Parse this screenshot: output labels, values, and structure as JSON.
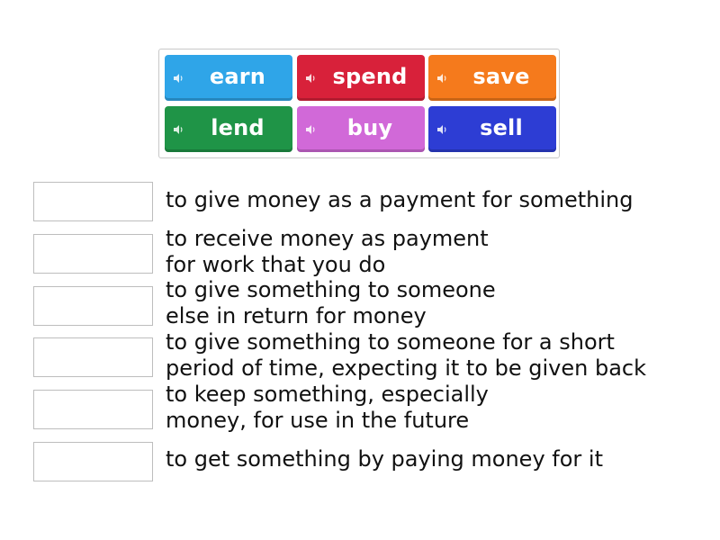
{
  "tiles": [
    {
      "label": "earn",
      "color": "#2fa5e8"
    },
    {
      "label": "spend",
      "color": "#d8213a"
    },
    {
      "label": "save",
      "color": "#f57a1c"
    },
    {
      "label": "lend",
      "color": "#1f9447"
    },
    {
      "label": "buy",
      "color": "#d169d8"
    },
    {
      "label": "sell",
      "color": "#2d3dd4"
    }
  ],
  "tile_icon": "speaker-icon",
  "definitions": [
    {
      "lines": [
        "to give money as a payment for something"
      ]
    },
    {
      "lines": [
        "to receive money as payment",
        "for work that you do"
      ]
    },
    {
      "lines": [
        "to give something to someone",
        "else in return for money"
      ]
    },
    {
      "lines": [
        "to give something to someone for a short",
        "period of time, expecting it to be given back"
      ]
    },
    {
      "lines": [
        "to keep something, especially",
        "money, for use in the future"
      ]
    },
    {
      "lines": [
        "to get something by paying money for it"
      ]
    }
  ]
}
